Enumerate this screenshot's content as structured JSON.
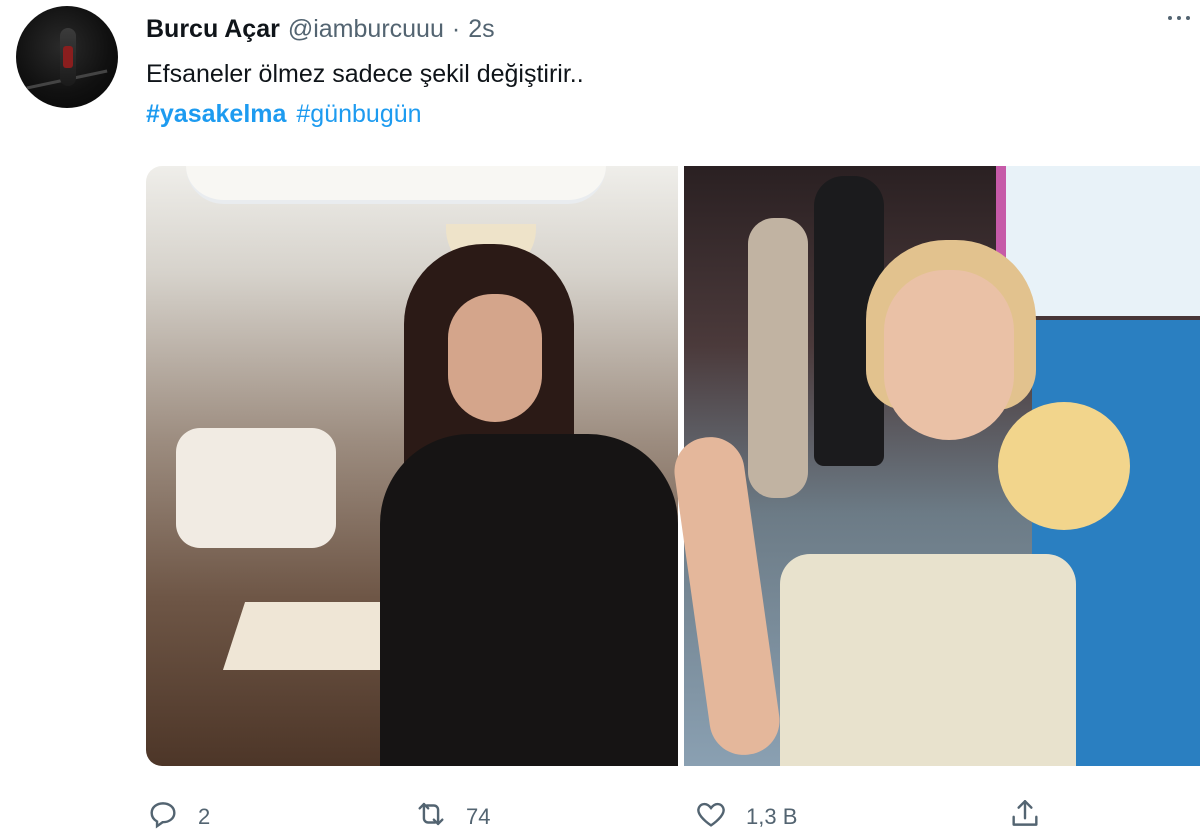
{
  "tweet": {
    "author_name": "Burcu Açar",
    "handle": "@iamburcuuu",
    "separator": "·",
    "time": "2s",
    "text": "Efsaneler ölmez sadece şekil değiştirir..",
    "hashtags": [
      "#yasakelma",
      "#günbugün"
    ]
  },
  "actions": {
    "reply_count": "2",
    "retweet_count": "74",
    "like_count": "1,3 B"
  },
  "icons": {
    "reply": "reply-icon",
    "retweet": "retweet-icon",
    "like": "heart-icon",
    "share": "share-icon",
    "more": "more-icon"
  },
  "colors": {
    "link": "#1d9bf0",
    "secondary_text": "#536471",
    "primary_text": "#0f1419"
  }
}
